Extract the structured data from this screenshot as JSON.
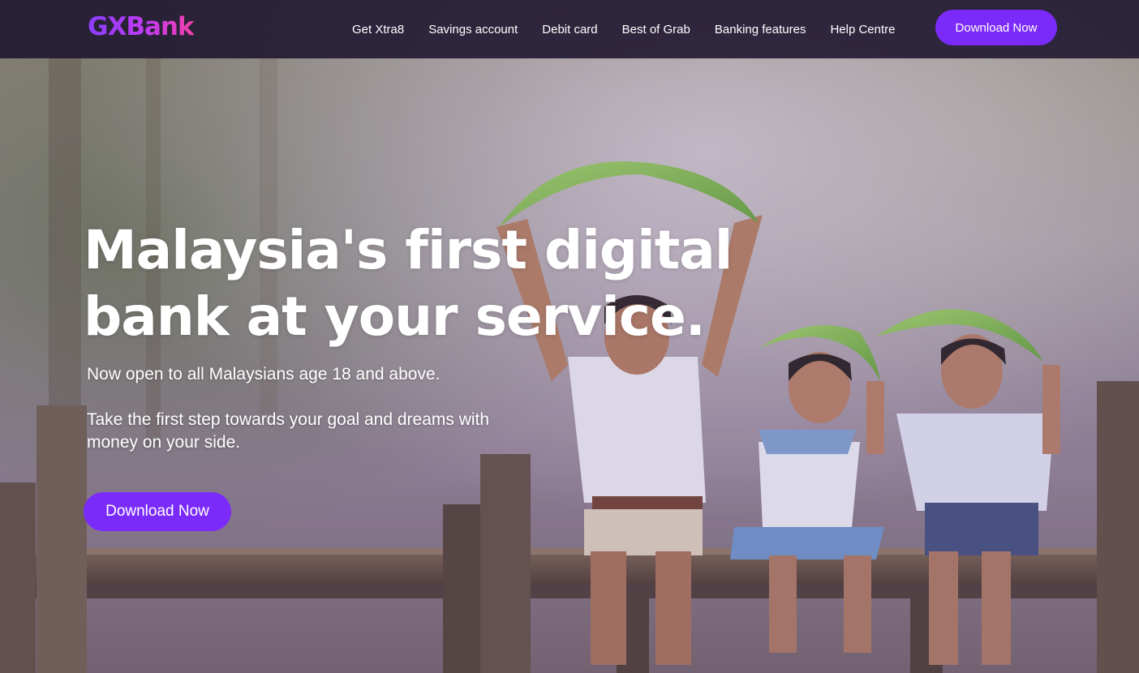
{
  "brand": {
    "logo_text": "GXBank",
    "accent_color": "#7b2bf9",
    "logo_gradient": [
      "#8a3dff",
      "#c03cf0",
      "#f03ea8"
    ]
  },
  "nav": {
    "links": [
      "Get Xtra8",
      "Savings account",
      "Debit card",
      "Best of Grab",
      "Banking features",
      "Help Centre"
    ],
    "cta_label": "Download Now"
  },
  "hero": {
    "title_line1": "Malaysia's first digital",
    "title_line2": "bank at your service.",
    "subtitle1": "Now open to all Malaysians age 18 and above.",
    "subtitle2": "Take the first step towards your goal and dreams with money on your side.",
    "cta_label": "Download Now",
    "image_subject": "children-on-wooden-bridge-with-banana-leaves"
  }
}
